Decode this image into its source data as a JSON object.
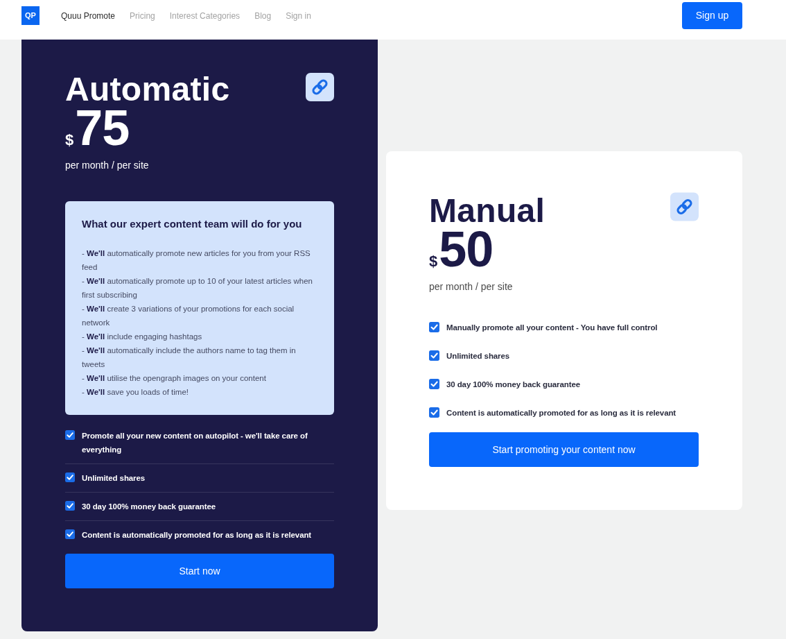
{
  "navbar": {
    "logo": "QP",
    "links": [
      {
        "label": "Quuu Promote",
        "selected": true
      },
      {
        "label": "Pricing",
        "selected": false
      },
      {
        "label": "Interest Categories",
        "selected": false
      },
      {
        "label": "Blog",
        "selected": false
      },
      {
        "label": "Sign in",
        "selected": false
      }
    ],
    "signup_button": "Sign up"
  },
  "plans": [
    {
      "kind": "featured",
      "title": "Automatic",
      "currency": "$",
      "price": "75",
      "period": "per month / per site",
      "team_box": {
        "heading": "What our expert content team will do for you",
        "items": [
          "- **We'll** automatically promote new articles for you from your RSS feed",
          "- **We'll** automatically promote up to 10 of your latest articles when first subscribing",
          "- **We'll** create 3 variations of your promotions for each social network",
          "- **We'll** include engaging hashtags",
          "- **We'll** automatically include the authors name to tag them in tweets",
          "- **We'll** utilise the opengraph images on your content",
          "- **We'll** save you loads of time!"
        ]
      },
      "features": [
        {
          "text": "Promote all your new content on autopilot - we'll take care of everything",
          "checked": true
        },
        {
          "text": "Unlimited shares",
          "checked": true
        },
        {
          "text": "30 day 100% money back guarantee",
          "checked": true
        },
        {
          "text": "Content is automatically promoted for as long as it is relevant",
          "checked": true
        }
      ],
      "button": "Start now"
    },
    {
      "kind": "plain",
      "title": "Manual",
      "currency": "$",
      "price": "50",
      "period": "per month / per site",
      "features": [
        {
          "text": "Manually promote all your content - You have full control",
          "checked": true
        },
        {
          "text": "Unlimited shares",
          "checked": true
        },
        {
          "text": "30 day 100% money back guarantee",
          "checked": true
        },
        {
          "text": "Content is automatically promoted for as long as it is relevant",
          "checked": true
        }
      ],
      "button": "Start promoting your content now"
    }
  ]
}
